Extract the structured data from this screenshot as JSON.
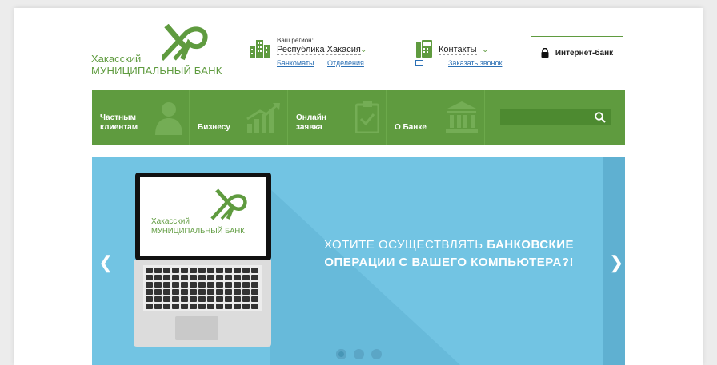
{
  "logo": {
    "line1": "Хакасский",
    "line2": "МУНИЦИПАЛЬНЫЙ БАНК"
  },
  "region": {
    "caption": "Ваш регион:",
    "value": "Республика Хакасия",
    "links": [
      "Банкоматы",
      "Отделения"
    ]
  },
  "contacts": {
    "label": "Контакты",
    "callback": "Заказать звонок"
  },
  "internet_bank": {
    "label": "Интернет-банк"
  },
  "nav": [
    {
      "label": "Частным\nклиентам"
    },
    {
      "label": "Бизнесу"
    },
    {
      "label": "Онлайн\nзаявка"
    },
    {
      "label": "О Банке"
    }
  ],
  "banner": {
    "laptop_logo_line1": "Хакасский",
    "laptop_logo_line2": "МУНИЦИПАЛЬНЫЙ БАНК",
    "headline_plain_1": "ХОТИТЕ ОСУЩЕСТВЛЯТЬ ",
    "headline_bold_1": "БАНКОВСКИЕ",
    "headline_bold_2": "ОПЕРАЦИИ С ВАШЕГО КОМПЬЮТЕРА?!",
    "prev": "❮",
    "next": "❯",
    "dots_count": 3,
    "active_dot": 1
  },
  "colors": {
    "brand_green": "#5f9b3f",
    "banner_blue": "#72c4e3",
    "link_blue": "#2a6fb4"
  }
}
